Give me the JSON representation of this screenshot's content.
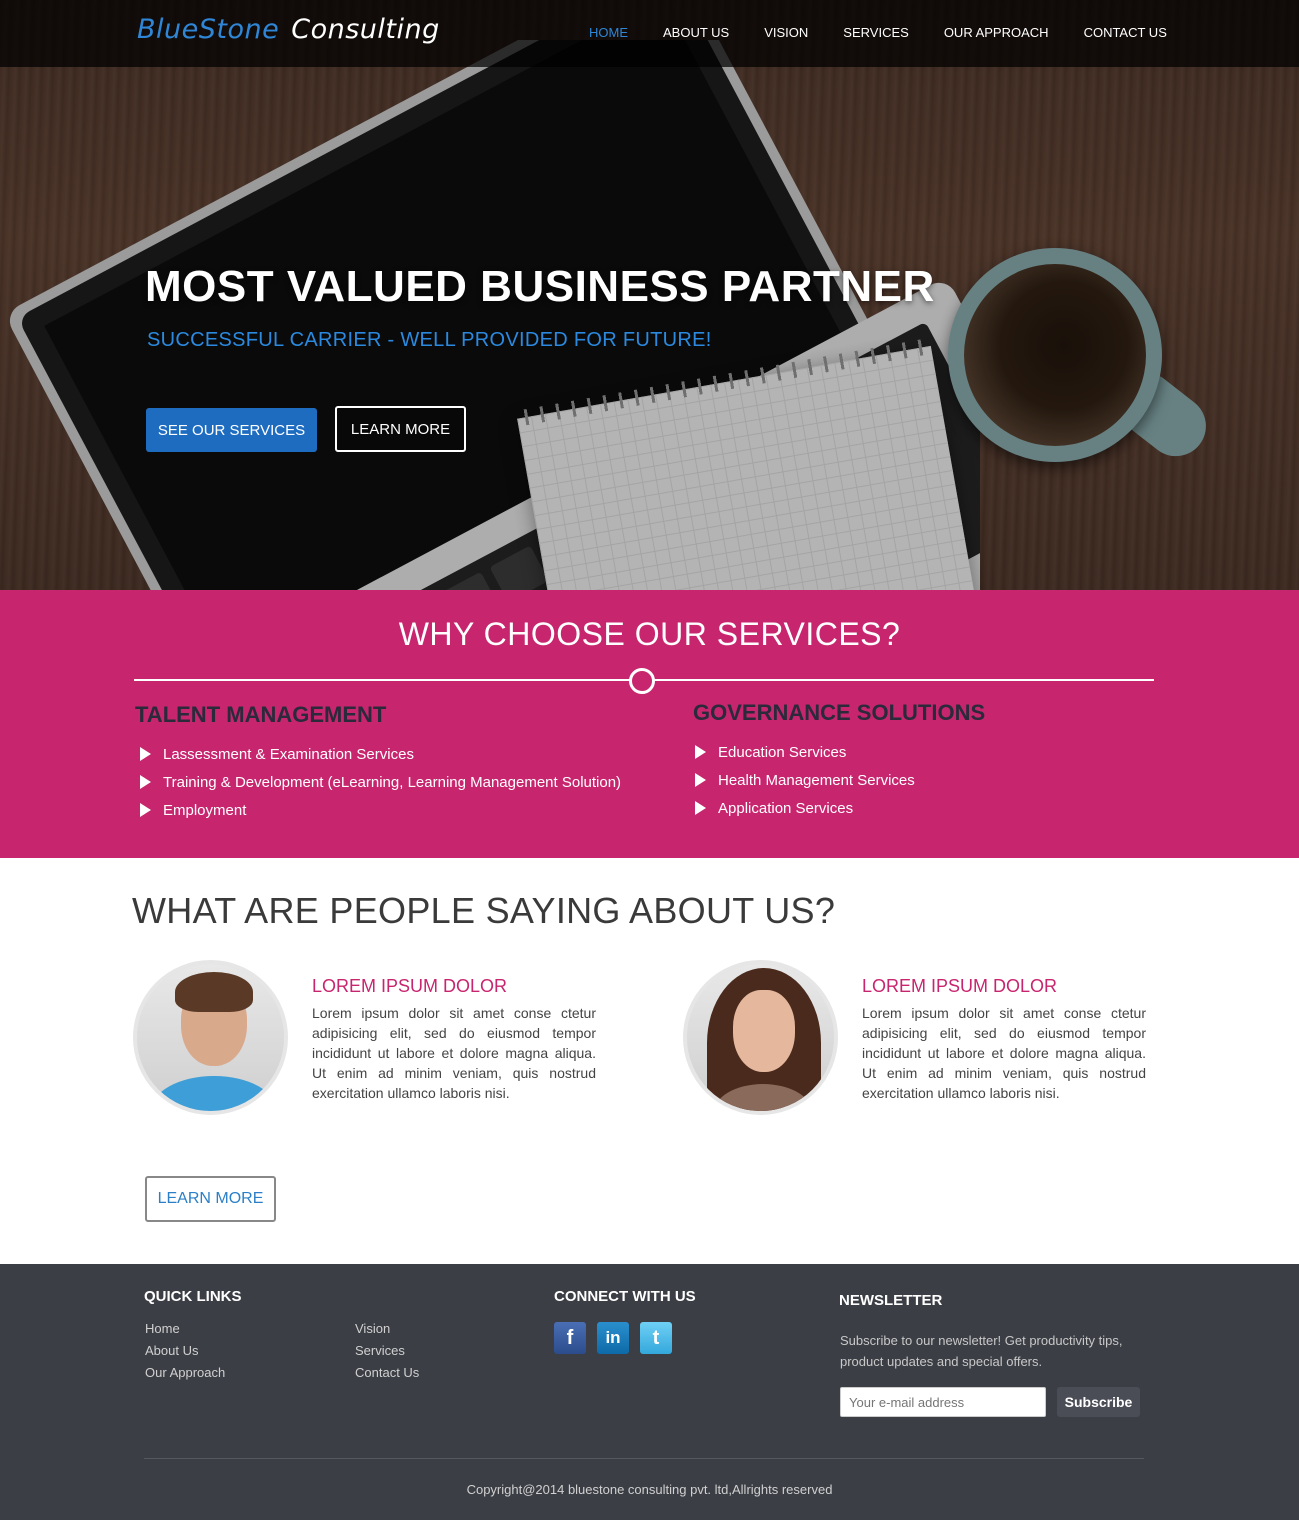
{
  "brand": {
    "name_part1": "BlueStone",
    "name_part2": "Consulting"
  },
  "nav": {
    "items": [
      "HOME",
      "ABOUT US",
      "VISION",
      "SERVICES",
      "OUR APPROACH",
      "CONTACT US"
    ],
    "active": "HOME"
  },
  "hero": {
    "title": "MOST VALUED BUSINESS PARTNER",
    "subtitle": "SUCCESSFUL CARRIER - WELL PROVIDED FOR FUTURE!",
    "primary_button": "SEE OUR SERVICES",
    "secondary_button": "LEARN MORE"
  },
  "why": {
    "title": "WHY CHOOSE OUR SERVICES?",
    "columns": [
      {
        "heading": "TALENT MANAGEMENT",
        "items": [
          "Lassessment & Examination Services",
          "Training & Development (eLearning, Learning Management Solution)",
          "Employment"
        ]
      },
      {
        "heading": "GOVERNANCE SOLUTIONS",
        "items": [
          "Education Services",
          "Health Management Services",
          "Application Services"
        ]
      }
    ]
  },
  "testimonials": {
    "title": "WHAT ARE PEOPLE SAYING ABOUT US?",
    "items": [
      {
        "name": "LOREM IPSUM DOLOR",
        "text": "Lorem ipsum dolor sit amet conse ctetur adipisicing elit, sed do eiusmod tempor incididunt ut labore et dolore magna aliqua. Ut enim ad minim veniam, quis nostrud exercitation ullamco laboris nisi."
      },
      {
        "name": "LOREM IPSUM DOLOR",
        "text": "Lorem ipsum dolor sit amet conse ctetur adipisicing elit, sed do eiusmod tempor incididunt ut labore et dolore magna aliqua. Ut enim ad minim veniam, quis nostrud exercitation ullamco laboris nisi."
      }
    ],
    "button": "LEARN MORE"
  },
  "footer": {
    "quick_links_title": "QUICK LINKS",
    "quick_links": [
      "Home",
      "About Us",
      "Our Approach",
      "Vision",
      "Services",
      "Contact Us"
    ],
    "connect_title": "CONNECT WITH US",
    "social": [
      "facebook-icon",
      "linkedin-icon",
      "twitter-icon"
    ],
    "newsletter_title": "NEWSLETTER",
    "newsletter_text": "Subscribe to our newsletter! Get productivity tips, product updates and special offers.",
    "email_placeholder": "Your e-mail address",
    "subscribe_label": "Subscribe",
    "copyright": "Copyright@2014 bluestone consulting pvt. ltd,Allrights reserved"
  },
  "colors": {
    "accent_blue": "#1e6cc0",
    "pink": "#c8256f",
    "footer_bg": "#3b3e45"
  }
}
